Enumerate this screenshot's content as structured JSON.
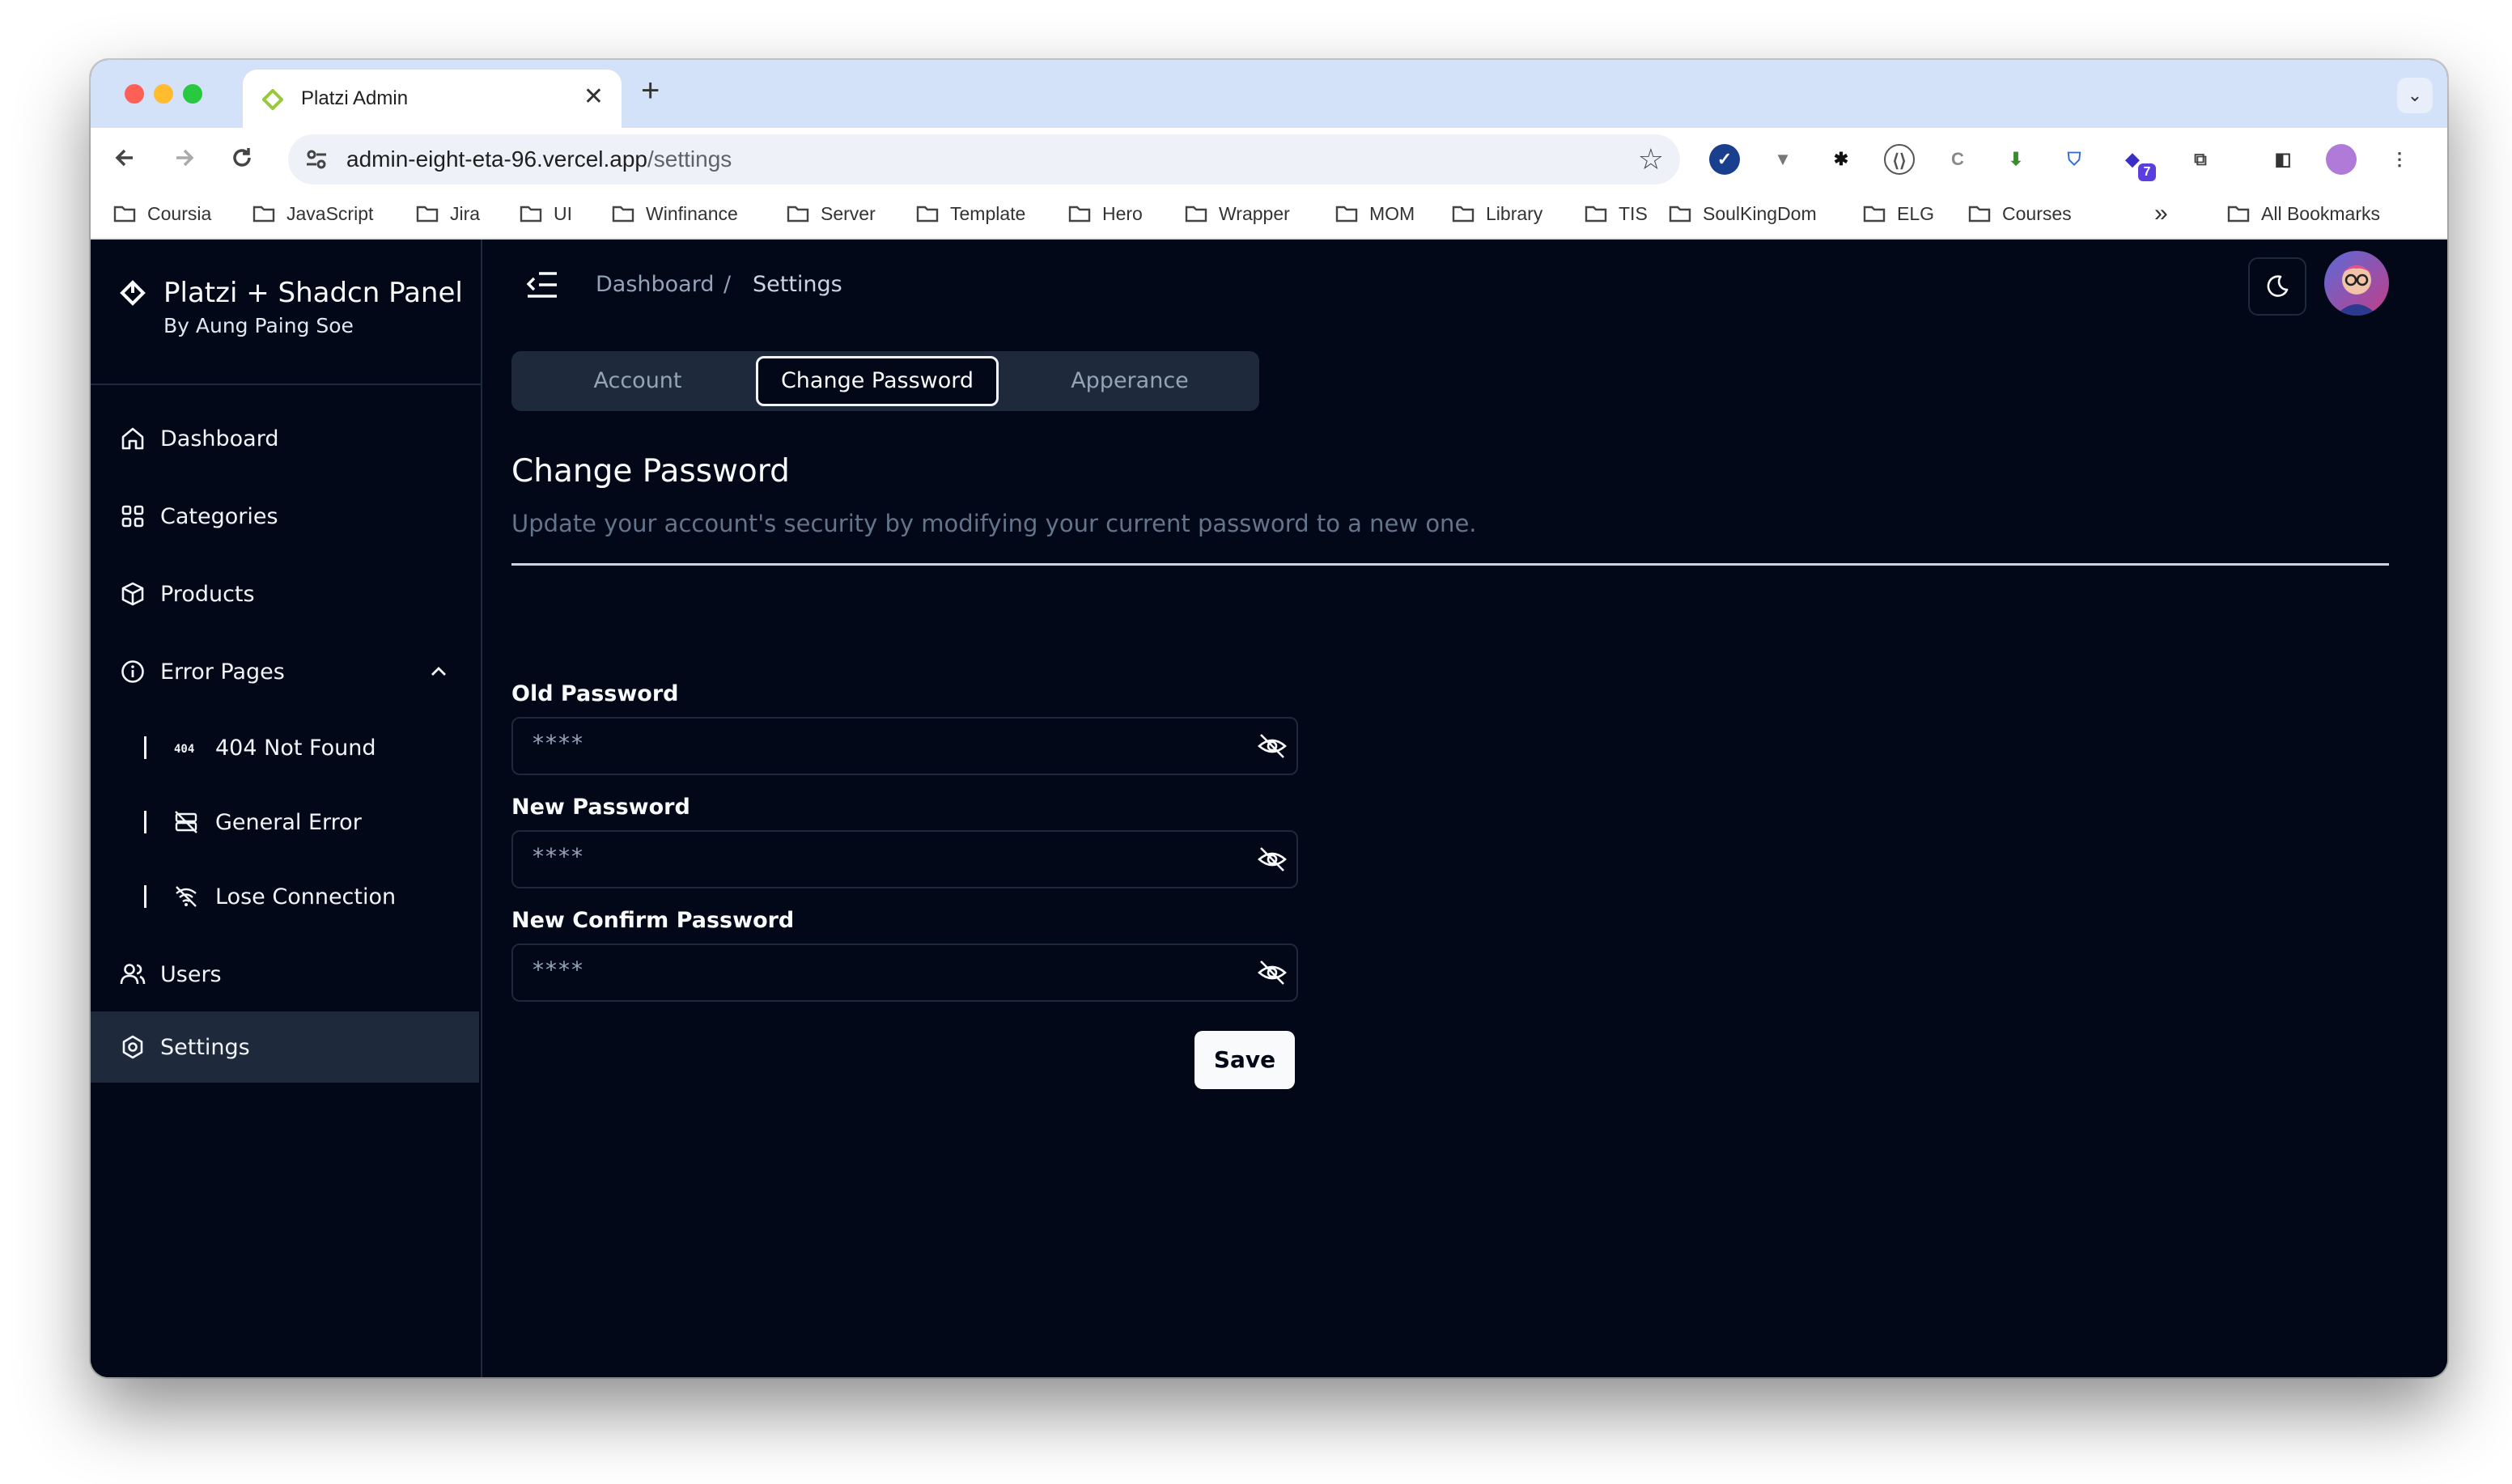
{
  "browser": {
    "tab_title": "Platzi Admin",
    "new_tab_glyph": "+",
    "close_glyph": "✕",
    "dropdown_glyph": "⌄",
    "url_host": "admin-eight-eta-96.vercel.app",
    "url_path": "/settings",
    "extension_badge": "7",
    "bookmarks": [
      "Coursia",
      "JavaScript",
      "Jira",
      "UI",
      "Winfinance",
      "Server",
      "Template",
      "Hero",
      "Wrapper",
      "MOM",
      "Library",
      "TIS",
      "SoulKingDom",
      "ELG",
      "Courses"
    ],
    "bookmarks_overflow": "»",
    "all_bookmarks": "All Bookmarks"
  },
  "sidebar": {
    "brand_title": "Platzi + Shadcn Panel",
    "brand_subtitle": "By Aung Paing Soe",
    "items": [
      {
        "label": "Dashboard",
        "icon": "home-icon"
      },
      {
        "label": "Categories",
        "icon": "grid-icon"
      },
      {
        "label": "Products",
        "icon": "package-icon"
      },
      {
        "label": "Error Pages",
        "icon": "info-icon"
      },
      {
        "label": "Users",
        "icon": "users-icon"
      },
      {
        "label": "Settings",
        "icon": "settings-icon",
        "active": true
      }
    ],
    "error_subitems": [
      {
        "label": "404 Not Found",
        "icon": "error-404-icon"
      },
      {
        "label": "General Error",
        "icon": "server-off-icon"
      },
      {
        "label": "Lose Connection",
        "icon": "wifi-off-icon"
      }
    ]
  },
  "header": {
    "breadcrumb": [
      "Dashboard",
      "Settings"
    ],
    "separator": "/"
  },
  "settings": {
    "tabs": [
      {
        "label": "Account"
      },
      {
        "label": "Change Password",
        "active": true
      },
      {
        "label": "Apperance"
      }
    ],
    "title": "Change Password",
    "description": "Update your account's security by modifying your current password to a new one.",
    "fields": [
      {
        "label": "Old Password",
        "value": "****"
      },
      {
        "label": "New Password",
        "value": "****"
      },
      {
        "label": "New Confirm Password",
        "value": "****"
      }
    ],
    "save_label": "Save"
  },
  "colors": {
    "app_background": "#020817",
    "muted": "#1e293b",
    "foreground": "#f8fafc",
    "muted_text": "#94a3b8"
  }
}
